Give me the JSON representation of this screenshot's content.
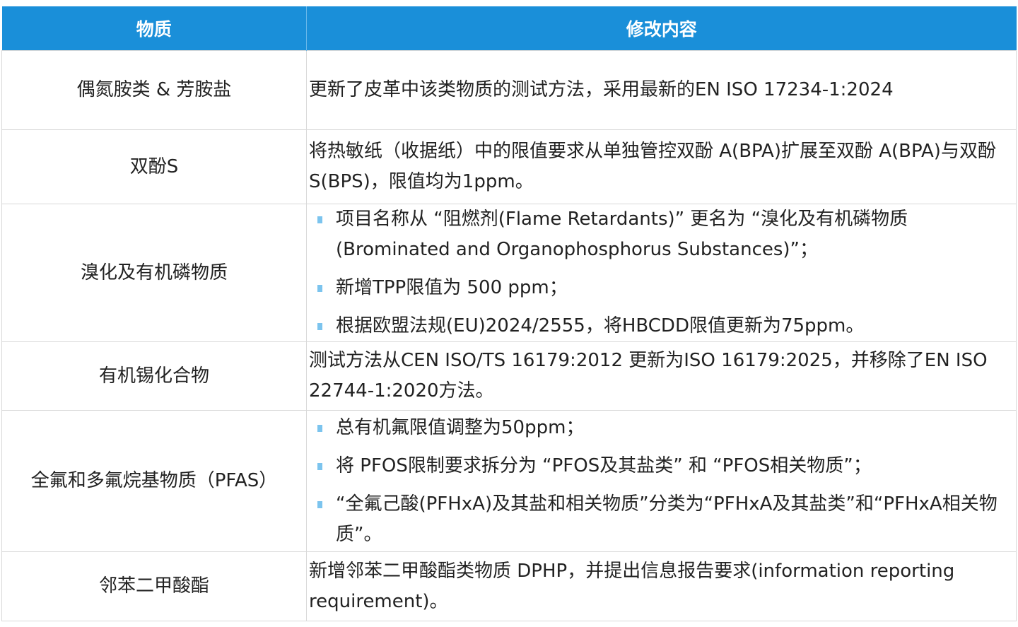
{
  "table": {
    "headers": [
      "物质",
      "修改内容"
    ],
    "rows": [
      {
        "substance": "偶氮胺类 & 芳胺盐",
        "content": "更新了皮革中该类物质的测试方法，采用最新的EN ISO 17234-1:2024"
      },
      {
        "substance": "双酚S",
        "content": "将热敏纸（收据纸）中的限值要求从单独管控双酚 A(BPA)扩展至双酚 A(BPA)与双酚 S(BPS)，限值均为1ppm。"
      },
      {
        "substance": "溴化及有机磷物质",
        "bullets": [
          "项目名称从 “阻燃剂(Flame Retardants)” 更名为 “溴化及有机磷物质(Brominated and Organophosphorus Substances)”；",
          "新增TPP限值为 500 ppm；",
          "根据欧盟法规(EU)2024/2555，将HBCDD限值更新为75ppm。"
        ]
      },
      {
        "substance": "有机锡化合物",
        "content": "测试方法从CEN ISO/TS 16179:2012 更新为ISO 16179:2025，并移除了EN ISO 22744-1:2020方法。"
      },
      {
        "substance": "全氟和多氟烷基物质（PFAS）",
        "bullets": [
          "总有机氟限值调整为50ppm；",
          "将 PFOS限制要求拆分为 “PFOS及其盐类” 和 “PFOS相关物质”；",
          "“全氟己酸(PFHxA)及其盐和相关物质”分类为“PFHxA及其盐类”和“PFHxA相关物质”。"
        ]
      },
      {
        "substance": "邻苯二甲酸酯",
        "content": "新增邻苯二甲酸酯类物质 DPHP，并提出信息报告要求(information reporting requirement)。"
      }
    ]
  },
  "colors": {
    "header_bg": "#1a8fd9",
    "bullet": "#7cc4ee",
    "border": "#d9d9d9"
  }
}
